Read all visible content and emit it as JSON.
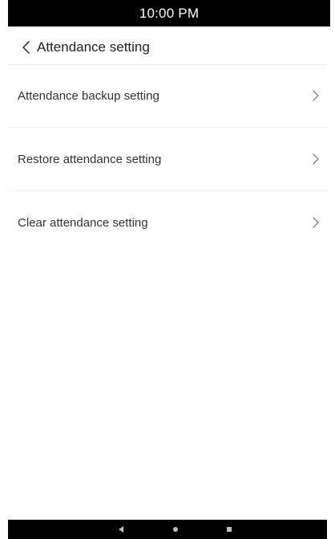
{
  "status_bar": {
    "time": "10:00 PM"
  },
  "header": {
    "title": "Attendance setting",
    "back_icon": "chevron-left-icon"
  },
  "settings_list": {
    "items": [
      {
        "label": "Attendance backup setting",
        "icon": "chevron-right-icon"
      },
      {
        "label": "Restore attendance setting",
        "icon": "chevron-right-icon"
      },
      {
        "label": "Clear attendance setting",
        "icon": "chevron-right-icon"
      }
    ]
  },
  "nav_bar": {
    "buttons": [
      "back-icon",
      "home-icon",
      "recent-apps-icon"
    ]
  },
  "colors": {
    "status_bar_bg": "#000000",
    "text_primary": "#222222",
    "text_item": "#333333",
    "divider": "#f0f0f0",
    "chevron": "#888888"
  }
}
